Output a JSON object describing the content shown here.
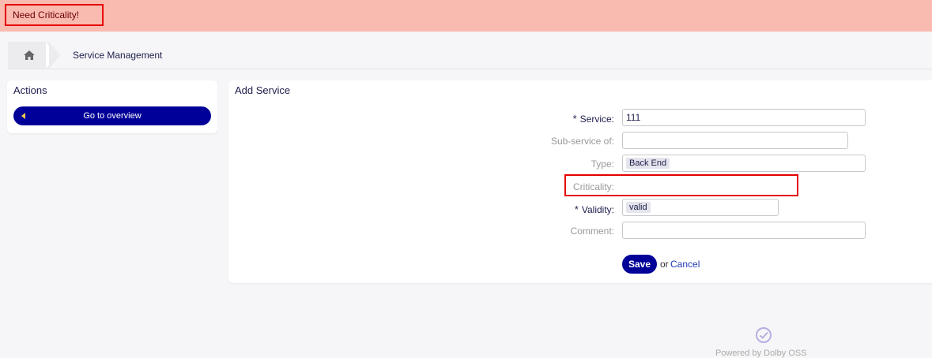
{
  "notification": {
    "message": "Need Criticality!"
  },
  "breadcrumb": {
    "home_icon": "home-icon",
    "current": "Service Management"
  },
  "actions": {
    "title": "Actions",
    "overview_button": "Go to overview"
  },
  "form": {
    "title": "Add Service",
    "fields": {
      "service": {
        "label": "Service:",
        "required": true,
        "value": "111"
      },
      "sub_service": {
        "label": "Sub-service of:",
        "required": false,
        "value": ""
      },
      "type": {
        "label": "Type:",
        "required": false,
        "value": "Back End"
      },
      "criticality": {
        "label": "Criticality:",
        "required": false,
        "value": ""
      },
      "validity": {
        "label": "Validity:",
        "required": true,
        "value": "valid"
      },
      "comment": {
        "label": "Comment:",
        "required": false,
        "value": ""
      }
    },
    "required_marker": "*",
    "save_label": "Save",
    "or_label": "or",
    "cancel_label": "Cancel"
  },
  "footer": {
    "icon": "check-circle-icon",
    "text": "Powered by Dolby OSS"
  },
  "colors": {
    "notice_bg": "#f9bab0",
    "highlight": "#e60000",
    "primary": "#000098",
    "link": "#1f3bb3"
  }
}
